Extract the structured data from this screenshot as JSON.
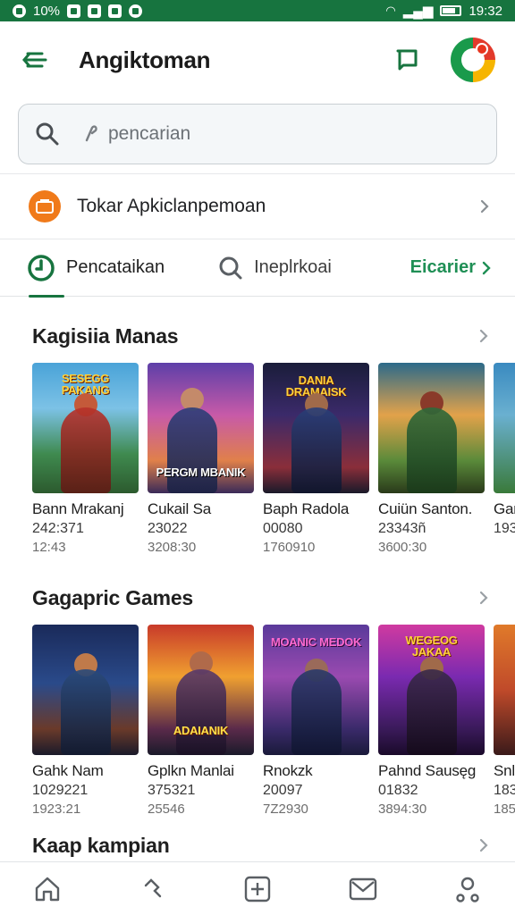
{
  "status_bar": {
    "battery_text": "10%",
    "time": "19:32"
  },
  "app_bar": {
    "title": "Angiktoman"
  },
  "search": {
    "placeholder": "pencarian"
  },
  "store_row": {
    "label": "Tokar Apkiclanpemoan"
  },
  "tabs": [
    {
      "label": "Pencataikan",
      "icon": "clock-icon"
    },
    {
      "label": "Ineplrkoai",
      "icon": "search-icon"
    },
    {
      "label": "Eicarier",
      "icon": "chevron-right-icon"
    }
  ],
  "sections": [
    {
      "title": "Kagisiia Manas",
      "items": [
        {
          "name": "Bann Mrakanj",
          "line1": "242:371",
          "line2": "12:43",
          "banner": "SESEGG PAKANG"
        },
        {
          "name": "Cukail Sa",
          "line1": "23022",
          "line2": "3208:30",
          "banner": "PERGM MBANIK"
        },
        {
          "name": "Baph Radola",
          "line1": "00080",
          "line2": "1760910",
          "banner": "DANIA DRAMAISK"
        },
        {
          "name": "Cuiün Santon.",
          "line1": "23343ñ",
          "line2": "3600:30",
          "banner": ""
        },
        {
          "name": "Gan",
          "line1": "193",
          "line2": "",
          "banner": ""
        }
      ]
    },
    {
      "title": "Gagapric Games",
      "items": [
        {
          "name": "Gahk Nam",
          "line1": "1029221",
          "line2": "1923:21",
          "banner": ""
        },
        {
          "name": "Gplkn Manlai",
          "line1": "375321",
          "line2": "25546",
          "banner": "ADAIANIK"
        },
        {
          "name": "Rnokzk",
          "line1": "20097",
          "line2": "7Z2930",
          "banner": "MOANIC MEDOK"
        },
        {
          "name": "Pahnd Sausęg",
          "line1": "01832",
          "line2": "3894:30",
          "banner": "WEGEOG JAKAA"
        },
        {
          "name": "Snl",
          "line1": "183",
          "line2": "185",
          "banner": ""
        }
      ]
    },
    {
      "title": "Kaap kampian",
      "items": []
    }
  ],
  "bottom_nav": [
    "home-icon",
    "explore-icon",
    "add-icon",
    "messages-icon",
    "profile-icon"
  ],
  "colors": {
    "brand_green": "#17743f",
    "accent_orange": "#f07a1a"
  }
}
